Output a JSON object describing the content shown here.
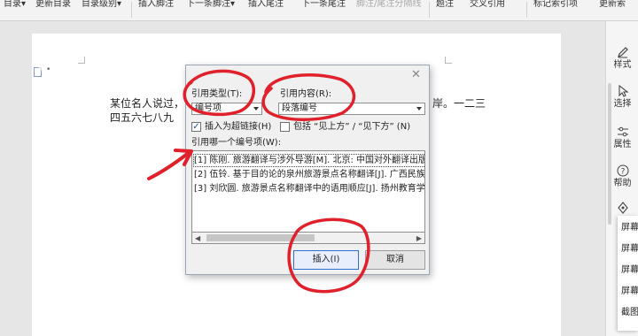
{
  "ribbon": {
    "items": [
      {
        "label": "目录▾"
      },
      {
        "label": "更新目录"
      },
      {
        "label": "目录级别▾"
      },
      {
        "label": "插入脚注"
      },
      {
        "label": "下一条脚注▾"
      },
      {
        "label": "插入尾注"
      },
      {
        "label": "下一条尾注"
      },
      {
        "label": "脚注/尾注分隔线"
      },
      {
        "label": "题注"
      },
      {
        "label": "交叉引用"
      },
      {
        "label": "标记索引项"
      },
      {
        "label": "更新索"
      }
    ]
  },
  "document": {
    "line1_left": "某位名人说过，",
    "line1_right": "岸。一二三",
    "line2": "四五六七八九"
  },
  "dialog": {
    "close_glyph": "✕",
    "ref_type_label": "引用类型(T):",
    "ref_type_value": "编号项",
    "ref_content_label": "引用内容(R):",
    "ref_content_value": "段落编号",
    "hyperlink_label": "插入为超链接(H)",
    "hyperlink_checked": "✓",
    "include_label": "包括 “见上方” / “见下方” (N)",
    "list_label": "引用哪一个编号项(W):",
    "items": [
      {
        "text": "[1] 陈刚. 旅游翻译与涉外导游[M]. 北京: 中国对外翻译出版"
      },
      {
        "text": "[2] 伍铃. 基于目的论的泉州旅游景点名称翻译[J]. 广西民族"
      },
      {
        "text": "[3] 刘欣圆. 旅游景点名称翻译中的语用顺应[J]. 扬州教育学"
      }
    ],
    "insert_button": "插入(I)",
    "cancel_button": "取消"
  },
  "right_panel": {
    "items": [
      {
        "label": "样式",
        "icon": "pen-icon"
      },
      {
        "label": "选择",
        "icon": "cursor-icon"
      },
      {
        "label": "属性",
        "icon": "sliders-icon"
      },
      {
        "label": "帮助",
        "icon": "help-icon"
      }
    ],
    "menu": [
      "屏幕",
      "屏幕",
      "屏幕",
      "屏幕",
      "截图"
    ]
  },
  "colors": {
    "annotation_red": "#e0202a",
    "primary_border": "#2b6fd1"
  }
}
